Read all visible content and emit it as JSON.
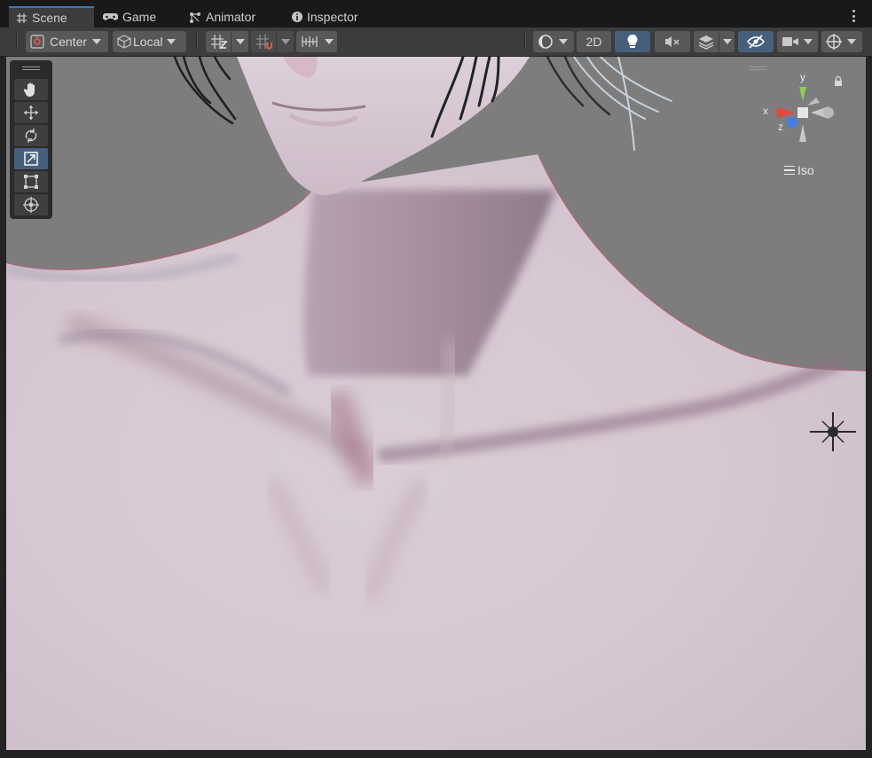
{
  "tabs": [
    {
      "label": "Scene",
      "icon": "scene-grid-icon",
      "active": true
    },
    {
      "label": "Game",
      "icon": "gamepad-icon",
      "active": false
    },
    {
      "label": "Animator",
      "icon": "animator-icon",
      "active": false
    },
    {
      "label": "Inspector",
      "icon": "info-icon",
      "active": false
    }
  ],
  "toolbar": {
    "pivot_mode": "Center",
    "pivot_rotation": "Local",
    "render_mode": "2D"
  },
  "tools": [
    "hand-tool",
    "move-tool",
    "rotate-tool",
    "scale-tool",
    "rect-tool",
    "transform-tool"
  ],
  "selected_tool": "scale-tool",
  "gizmo": {
    "axis_x": "x",
    "axis_y": "y",
    "axis_z": "z",
    "projection": "Iso",
    "colors": {
      "x": "#e8453c",
      "y": "#8fd14a",
      "z": "#3f7fe6"
    }
  },
  "accent_color": "#46607c"
}
